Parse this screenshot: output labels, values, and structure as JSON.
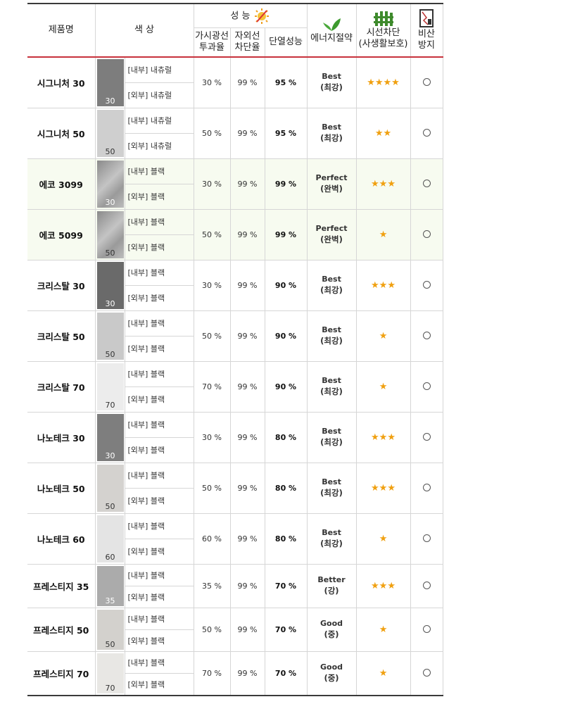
{
  "header": {
    "product_name": "제품명",
    "color": "색 상",
    "performance": "성 능",
    "visible_light": "가시광선\n투과율",
    "uv_block": "자외선\n차단율",
    "insulation": "단열성능",
    "energy_saving": "에너지절약",
    "privacy": "시선차단\n(사생활보호)",
    "shatter_proof": "비산\n방지",
    "icons": {
      "performance": "sun-heat-icon",
      "energy": "leaf-icon",
      "privacy": "fence-icon",
      "shatter": "glass-shield-icon"
    }
  },
  "colors": {
    "accent_line": "#c8323c",
    "star": "#f0a010",
    "alt_row": "#f7fbf0"
  },
  "rows": [
    {
      "name": "시그니처 30",
      "swatch_num": "30",
      "swatch_color": "#7d7d7d",
      "inner": "[내부] 내츄럴",
      "outer": "[외부] 내츄럴",
      "vlt": "30 %",
      "uv": "99 %",
      "heat": "95 %",
      "energy": "Best",
      "energy_sub": "(최강)",
      "stars": "★★★★",
      "shatter": "○"
    },
    {
      "name": "시그니처 50",
      "swatch_num": "50",
      "swatch_color": "#cfcfcf",
      "inner": "[내부] 내츄럴",
      "outer": "[외부] 내츄럴",
      "vlt": "50 %",
      "uv": "99 %",
      "heat": "95 %",
      "energy": "Best",
      "energy_sub": "(최강)",
      "stars": "★★",
      "shatter": "○"
    },
    {
      "name": "에코 3099",
      "swatch_num": "30",
      "swatch_color": "#9a9a9a",
      "inner": "[내부] 블랙",
      "outer": "[외부] 블랙",
      "vlt": "30 %",
      "uv": "99 %",
      "heat": "99 %",
      "energy": "Perfect",
      "energy_sub": "(완벽)",
      "stars": "★★★",
      "shatter": "○"
    },
    {
      "name": "에코 5099",
      "swatch_num": "50",
      "swatch_color": "#cdcdcd",
      "inner": "[내부] 블랙",
      "outer": "[외부] 블랙",
      "vlt": "50 %",
      "uv": "99 %",
      "heat": "99 %",
      "energy": "Perfect",
      "energy_sub": "(완벽)",
      "stars": "★",
      "shatter": "○"
    },
    {
      "name": "크리스탈 30",
      "swatch_num": "30",
      "swatch_color": "#6a6a6a",
      "inner": "[내부] 블랙",
      "outer": "[외부] 블랙",
      "vlt": "30 %",
      "uv": "99 %",
      "heat": "90 %",
      "energy": "Best",
      "energy_sub": "(최강)",
      "stars": "★★★",
      "shatter": "○"
    },
    {
      "name": "크리스탈 50",
      "swatch_num": "50",
      "swatch_color": "#c9c9c9",
      "inner": "[내부] 블랙",
      "outer": "[외부] 블랙",
      "vlt": "50 %",
      "uv": "99 %",
      "heat": "90 %",
      "energy": "Best",
      "energy_sub": "(최강)",
      "stars": "★",
      "shatter": "○"
    },
    {
      "name": "크리스탈 70",
      "swatch_num": "70",
      "swatch_color": "#ececec",
      "inner": "[내부] 블랙",
      "outer": "[외부] 블랙",
      "vlt": "70 %",
      "uv": "99 %",
      "heat": "90 %",
      "energy": "Best",
      "energy_sub": "(최강)",
      "stars": "★",
      "shatter": "○"
    },
    {
      "name": "나노테크 30",
      "swatch_num": "30",
      "swatch_color": "#7e7e7e",
      "inner": "[내부] 블랙",
      "outer": "[외부] 블랙",
      "vlt": "30 %",
      "uv": "99 %",
      "heat": "80 %",
      "energy": "Best",
      "energy_sub": "(최강)",
      "stars": "★★★",
      "shatter": "○"
    },
    {
      "name": "나노테크 50",
      "swatch_num": "50",
      "swatch_color": "#d4d2cf",
      "inner": "[내부] 블랙",
      "outer": "[외부] 블랙",
      "vlt": "50 %",
      "uv": "99 %",
      "heat": "80 %",
      "energy": "Best",
      "energy_sub": "(최강)",
      "stars": "★★★",
      "shatter": "○"
    },
    {
      "name": "나노테크 60",
      "swatch_num": "60",
      "swatch_color": "#e4e4e4",
      "inner": "[내부] 블랙",
      "outer": "[외부] 블랙",
      "vlt": "60 %",
      "uv": "99 %",
      "heat": "80 %",
      "energy": "Best",
      "energy_sub": "(최강)",
      "stars": "★",
      "shatter": "○"
    },
    {
      "name": "프레스티지 35",
      "swatch_num": "35",
      "swatch_color": "#ababab",
      "inner": "[내부] 블랙",
      "outer": "[외부] 블랙",
      "vlt": "35 %",
      "uv": "99 %",
      "heat": "70 %",
      "energy": "Better",
      "energy_sub": "(강)",
      "stars": "★★★",
      "shatter": "○"
    },
    {
      "name": "프레스티지 50",
      "swatch_num": "50",
      "swatch_color": "#d3d1cd",
      "inner": "[내부] 블랙",
      "outer": "[외부] 블랙",
      "vlt": "50 %",
      "uv": "99 %",
      "heat": "70 %",
      "energy": "Good",
      "energy_sub": "(중)",
      "stars": "★",
      "shatter": "○"
    },
    {
      "name": "프레스티지 70",
      "swatch_num": "70",
      "swatch_color": "#e8e7e4",
      "inner": "[내부] 블랙",
      "outer": "[외부] 블랙",
      "vlt": "70 %",
      "uv": "99 %",
      "heat": "70 %",
      "energy": "Good",
      "energy_sub": "(중)",
      "stars": "★",
      "shatter": "○"
    }
  ]
}
